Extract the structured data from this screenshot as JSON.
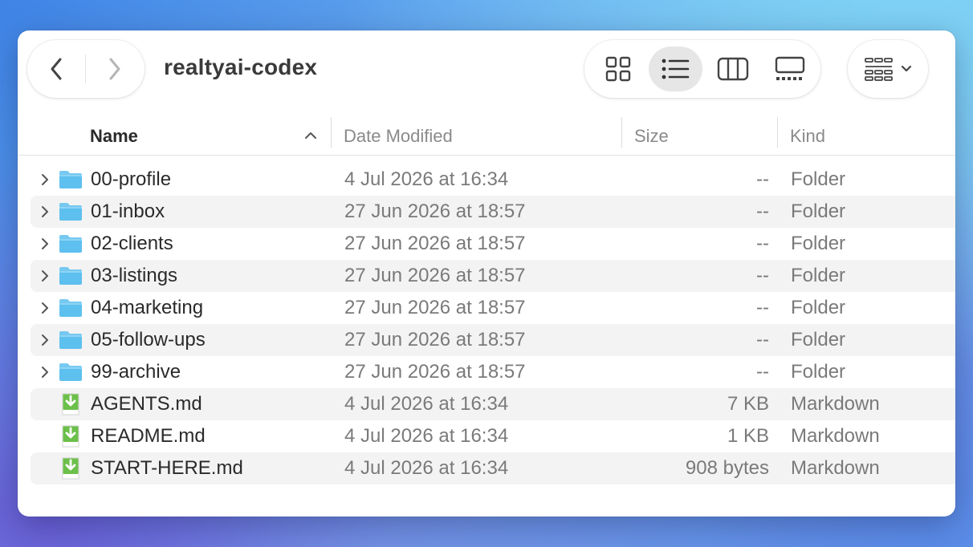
{
  "window": {
    "title": "realtyai-codex"
  },
  "toolbar": {
    "back_icon": "chevron-left-icon",
    "forward_icon": "chevron-right-icon",
    "views": [
      {
        "name": "icon-view",
        "icon": "grid-icon",
        "active": false
      },
      {
        "name": "list-view",
        "icon": "list-icon",
        "active": true
      },
      {
        "name": "column-view",
        "icon": "columns-icon",
        "active": false
      },
      {
        "name": "gallery-view",
        "icon": "gallery-icon",
        "active": false
      }
    ],
    "group_icon": "group-grid-icon"
  },
  "columns": {
    "name": "Name",
    "date": "Date Modified",
    "size": "Size",
    "kind": "Kind"
  },
  "files": [
    {
      "name": "00-profile",
      "date": "4 Jul 2026 at 16:34",
      "size": "--",
      "kind": "Folder",
      "type": "folder"
    },
    {
      "name": "01-inbox",
      "date": "27 Jun 2026 at 18:57",
      "size": "--",
      "kind": "Folder",
      "type": "folder"
    },
    {
      "name": "02-clients",
      "date": "27 Jun 2026 at 18:57",
      "size": "--",
      "kind": "Folder",
      "type": "folder"
    },
    {
      "name": "03-listings",
      "date": "27 Jun 2026 at 18:57",
      "size": "--",
      "kind": "Folder",
      "type": "folder"
    },
    {
      "name": "04-marketing",
      "date": "27 Jun 2026 at 18:57",
      "size": "--",
      "kind": "Folder",
      "type": "folder"
    },
    {
      "name": "05-follow-ups",
      "date": "27 Jun 2026 at 18:57",
      "size": "--",
      "kind": "Folder",
      "type": "folder"
    },
    {
      "name": "99-archive",
      "date": "27 Jun 2026 at 18:57",
      "size": "--",
      "kind": "Folder",
      "type": "folder"
    },
    {
      "name": "AGENTS.md",
      "date": "4 Jul 2026 at 16:34",
      "size": "7 KB",
      "kind": "Markdown",
      "type": "markdown"
    },
    {
      "name": "README.md",
      "date": "4 Jul 2026 at 16:34",
      "size": "1 KB",
      "kind": "Markdown",
      "type": "markdown"
    },
    {
      "name": "START-HERE.md",
      "date": "4 Jul 2026 at 16:34",
      "size": "908 bytes",
      "kind": "Markdown",
      "type": "markdown"
    }
  ],
  "colors": {
    "folder": "#5ec0ee",
    "markdown": "#6cc04a"
  }
}
